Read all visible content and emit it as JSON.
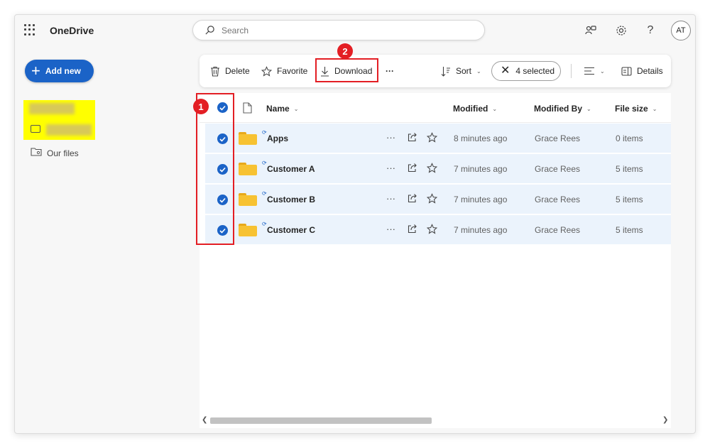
{
  "app": {
    "title": "OneDrive"
  },
  "search": {
    "placeholder": "Search"
  },
  "topbar": {
    "help_label": "?",
    "avatar_initials": "AT"
  },
  "sidebar": {
    "add_new_label": "Add new",
    "our_files_label": "Our files"
  },
  "commandbar": {
    "delete_label": "Delete",
    "favorite_label": "Favorite",
    "download_label": "Download",
    "more_label": "···",
    "sort_label": "Sort",
    "selected_label": "4 selected",
    "details_label": "Details"
  },
  "annotations": {
    "badge_1": "1",
    "badge_2": "2"
  },
  "list": {
    "columns": {
      "name": "Name",
      "modified": "Modified",
      "modified_by": "Modified By",
      "file_size": "File size"
    },
    "rows": [
      {
        "name": "Apps",
        "modified": "8 minutes ago",
        "modified_by": "Grace Rees",
        "file_size": "0 items"
      },
      {
        "name": "Customer A",
        "modified": "7 minutes ago",
        "modified_by": "Grace Rees",
        "file_size": "5 items"
      },
      {
        "name": "Customer B",
        "modified": "7 minutes ago",
        "modified_by": "Grace Rees",
        "file_size": "5 items"
      },
      {
        "name": "Customer C",
        "modified": "7 minutes ago",
        "modified_by": "Grace Rees",
        "file_size": "5 items"
      }
    ],
    "row_more_label": "···"
  },
  "colors": {
    "accent": "#1b63c7",
    "highlight": "#ffff00",
    "annotation_red": "#e31e24",
    "selected_row": "#ebf3fc",
    "folder": "#f7c232"
  }
}
